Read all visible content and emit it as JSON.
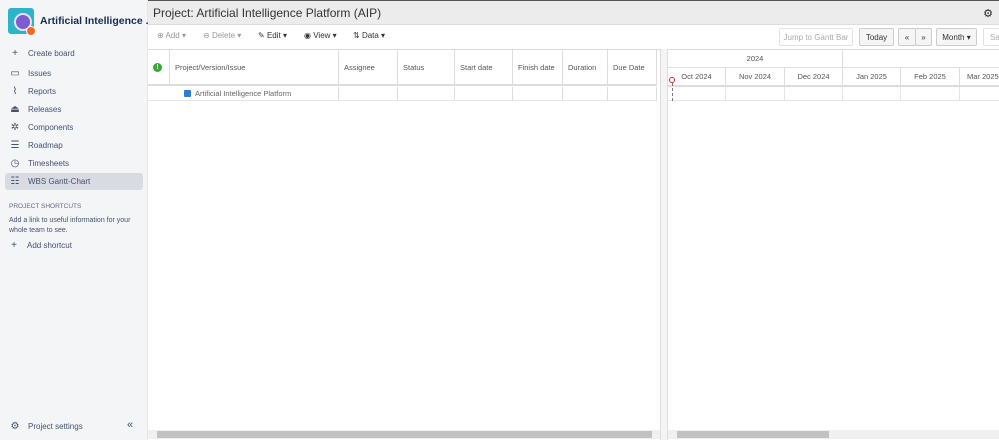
{
  "sidebar": {
    "project_name": "Artificial Intelligence ...",
    "items": [
      {
        "label": "Create board",
        "icon": "plus-icon"
      },
      {
        "label": "Issues",
        "icon": "issues-icon"
      },
      {
        "label": "Reports",
        "icon": "reports-icon"
      },
      {
        "label": "Releases",
        "icon": "releases-icon"
      },
      {
        "label": "Components",
        "icon": "components-icon"
      },
      {
        "label": "Roadmap",
        "icon": "roadmap-icon"
      },
      {
        "label": "Timesheets",
        "icon": "clock-icon"
      },
      {
        "label": "WBS Gantt-Chart",
        "icon": "gantt-icon"
      }
    ],
    "shortcuts_heading": "PROJECT SHORTCUTS",
    "shortcuts_desc": "Add a link to useful information for your whole team to see.",
    "add_shortcut": "Add shortcut",
    "settings": "Project settings"
  },
  "header": {
    "title": "Project:  Artificial Intelligence Platform (AIP)"
  },
  "toolbar": {
    "add": "Add ▾",
    "delete": "Delete ▾",
    "edit": "Edit ▾",
    "view": "View ▾",
    "data": "Data ▾",
    "jump": "Jump to Gantt Bar",
    "today": "Today",
    "prev": "«",
    "next": "»",
    "scale": "Month ▾",
    "save": "Save"
  },
  "grid": {
    "columns": [
      "Project/Version/Issue",
      "Assignee",
      "Status",
      "Start date",
      "Finish date",
      "Duration",
      "Due Date"
    ],
    "rows": [
      {
        "name": "Artificial Intelligence Platform"
      }
    ]
  },
  "gantt": {
    "year": "2024",
    "months": [
      "Oct 2024",
      "Nov 2024",
      "Dec 2024",
      "Jan 2025",
      "Feb 2025",
      "Mar 2025"
    ]
  },
  "colors": {
    "accent": "#f26b1d",
    "active_nav": "#d9dbe2",
    "today_marker": "#e5262b"
  }
}
